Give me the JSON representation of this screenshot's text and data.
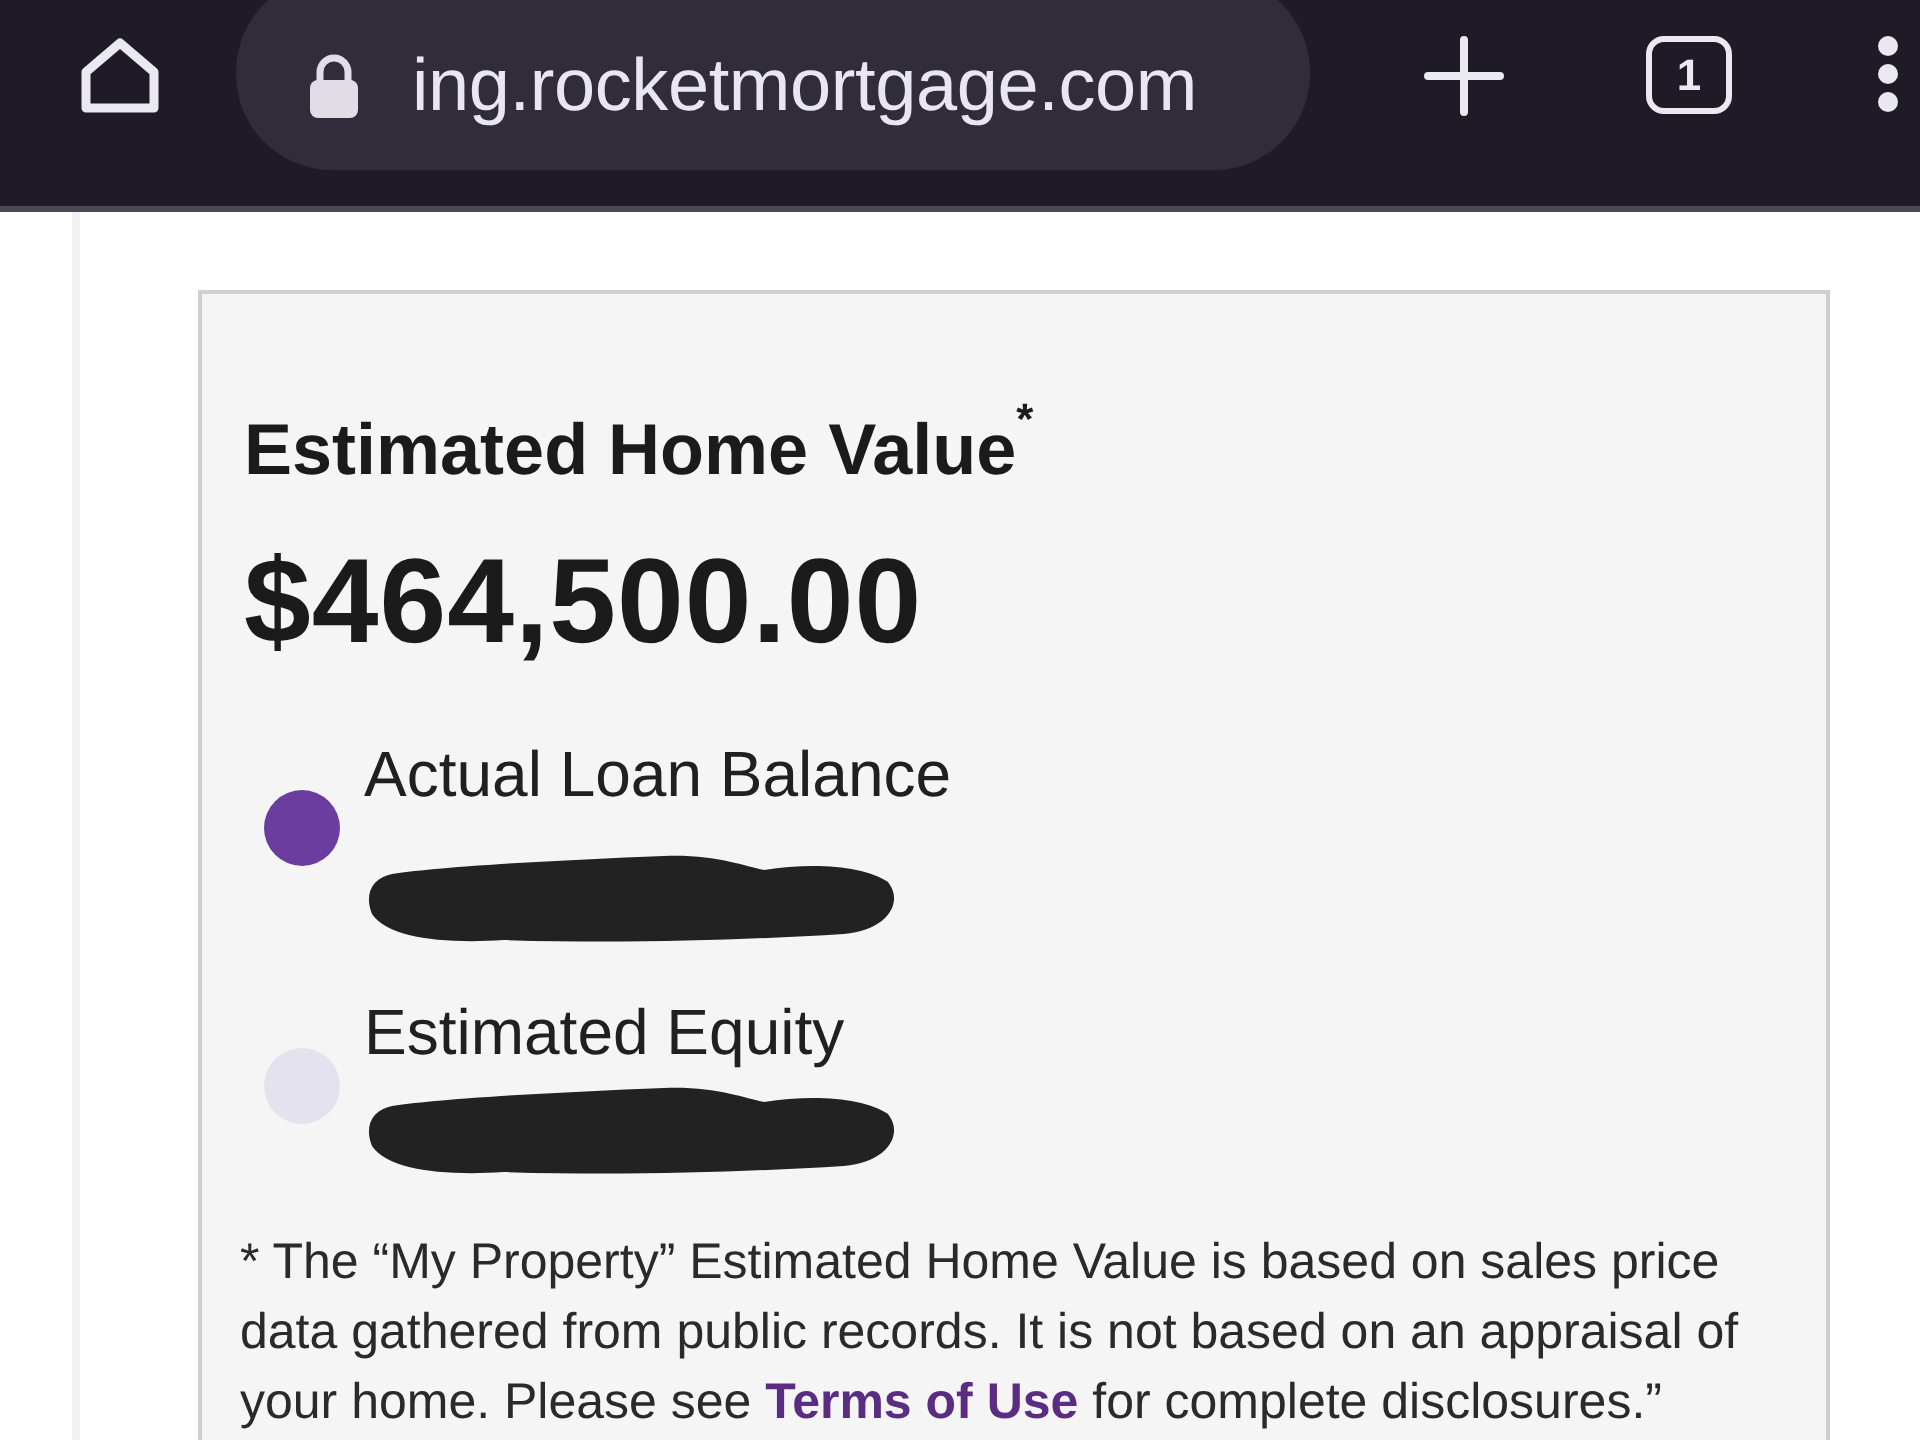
{
  "browser_bar": {
    "url": "ing.rocketmortgage.com",
    "tab_count": "1"
  },
  "card": {
    "title": "Estimated Home Value$^{*}$",
    "value": "$464,500.00",
    "legend": [
      {
        "label": "Actual Loan Balance",
        "color": "#6a3d9e",
        "redacted": true
      },
      {
        "label": "Estimated Equity",
        "color": "#e4e2ee",
        "redacted": true
      }
    ],
    "footnote": {
      "before": "* The “My Property” Estimated Home Value is based on sales price data gathered from public records. It is not based on an appraisal of your home. Please see ",
      "link": "Terms of Use",
      "after": " for complete disclosures.”"
    }
  }
}
